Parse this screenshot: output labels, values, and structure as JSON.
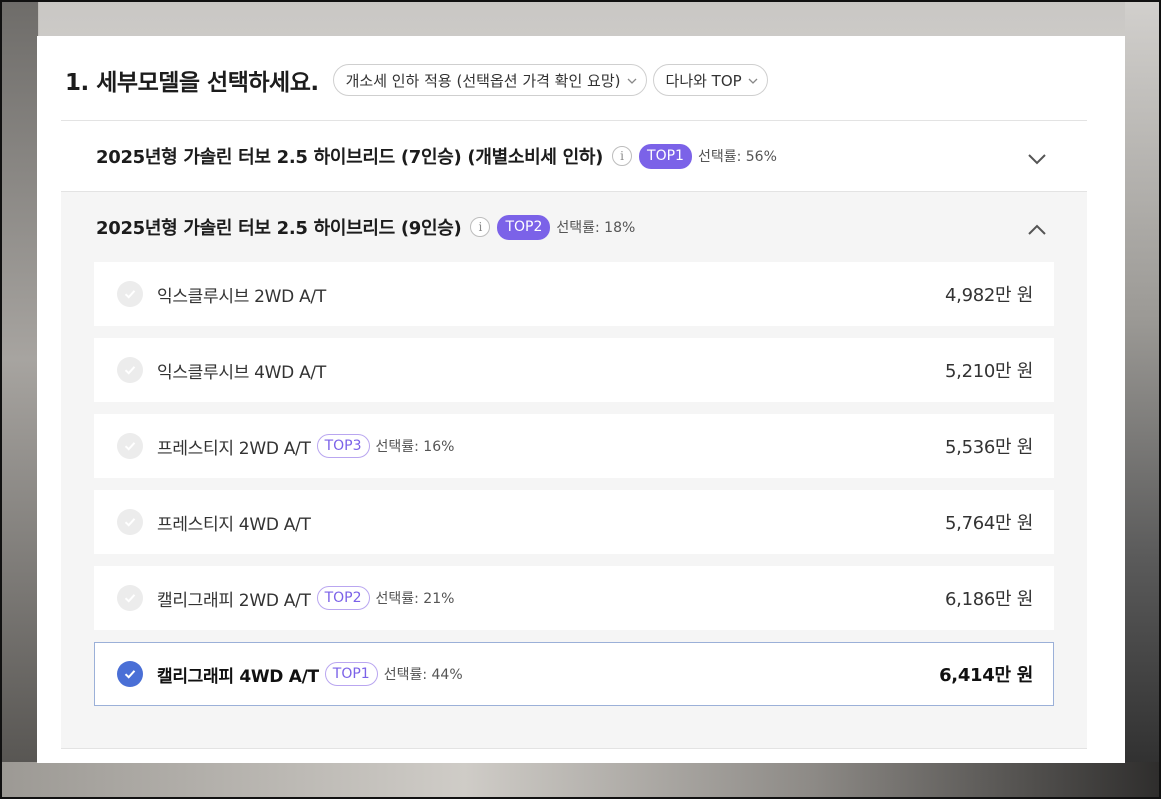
{
  "header": {
    "title": "1. 세부모델을 선택하세요.",
    "filter_chip": "개소세 인하 적용 (선택옵션 가격 확인 요망)",
    "sort_chip": "다나와 TOP"
  },
  "groups": [
    {
      "title": "2025년형 가솔린 터보 2.5 하이브리드 (7인승) (개별소비세 인하)",
      "info_icon": "i",
      "badge": "TOP1",
      "rate": "선택률: 56%",
      "state": "collapsed"
    },
    {
      "title": "2025년형 가솔린 터보 2.5 하이브리드 (9인승)",
      "info_icon": "i",
      "badge": "TOP2",
      "rate": "선택률: 18%",
      "state": "expanded",
      "options": [
        {
          "name": "익스클루시브 2WD A/T",
          "badge": "",
          "rate": "",
          "price": "4,982만 원",
          "selected": false
        },
        {
          "name": "익스클루시브 4WD A/T",
          "badge": "",
          "rate": "",
          "price": "5,210만 원",
          "selected": false
        },
        {
          "name": "프레스티지 2WD A/T",
          "badge": "TOP3",
          "rate": "선택률: 16%",
          "price": "5,536만 원",
          "selected": false
        },
        {
          "name": "프레스티지 4WD A/T",
          "badge": "",
          "rate": "",
          "price": "5,764만 원",
          "selected": false
        },
        {
          "name": "캘리그래피 2WD A/T",
          "badge": "TOP2",
          "rate": "선택률: 21%",
          "price": "6,186만 원",
          "selected": false
        },
        {
          "name": "캘리그래피 4WD A/T",
          "badge": "TOP1",
          "rate": "선택률: 44%",
          "price": "6,414만 원",
          "selected": true
        }
      ]
    }
  ],
  "colors": {
    "badge_purple": "#7b62e8",
    "check_selected": "#4a6fd6",
    "check_unselected": "#ececec"
  }
}
